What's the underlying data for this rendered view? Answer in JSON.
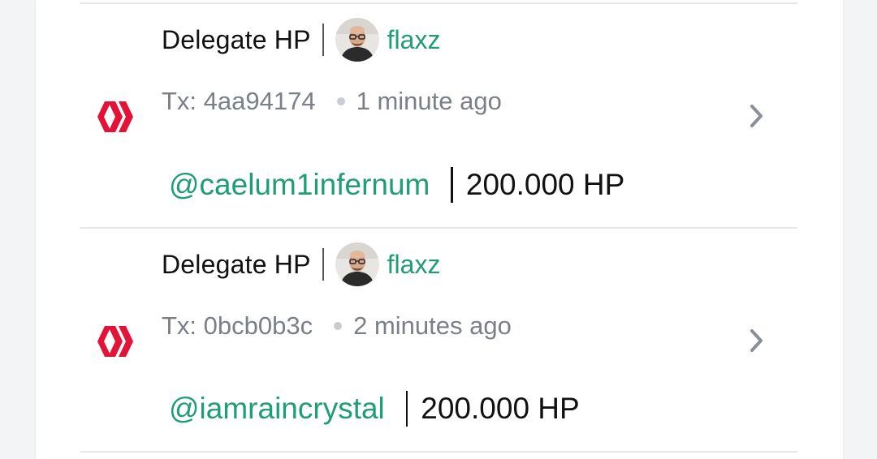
{
  "feed": {
    "items": [
      {
        "operation": "Delegate HP",
        "user": "flaxz",
        "tx_label": "Tx: 4aa94174",
        "time": "1 minute ago",
        "target": "@caelum1infernum",
        "amount": "200.000 HP"
      },
      {
        "operation": "Delegate HP",
        "user": "flaxz",
        "tx_label": "Tx: 0bcb0b3c",
        "time": "2 minutes ago",
        "target": "@iamraincrystal",
        "amount": "200.000 HP"
      }
    ]
  },
  "colors": {
    "accent": "#1f9d73",
    "hive_red": "#e31337",
    "muted": "#7b7f87"
  },
  "icons": {
    "operation": "hive-logo-icon",
    "avatar": "user-avatar",
    "expand": "chevron-right-icon"
  }
}
